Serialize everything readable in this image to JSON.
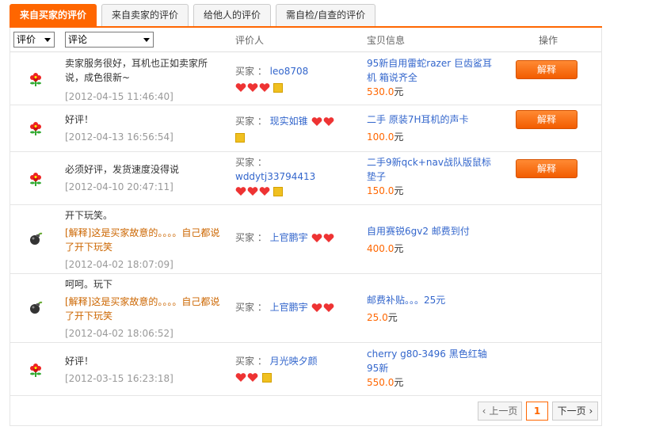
{
  "tabs": [
    {
      "label": "来自买家的评价",
      "active": true
    },
    {
      "label": "来自卖家的评价",
      "active": false
    },
    {
      "label": "给他人的评价",
      "active": false
    },
    {
      "label": "需自检/自查的评价",
      "active": false
    }
  ],
  "header": {
    "filter_rating": "评价",
    "filter_comment": "评论",
    "col_reviewer": "评价人",
    "col_item": "宝贝信息",
    "col_action": "操作"
  },
  "rows": [
    {
      "icon": "flower-icon",
      "comment": "卖家服务很好，耳机也正如卖家所说，成色很新~",
      "reply": "",
      "time": "[2012-04-15 11:46:40]",
      "buyer_label": "买家 ：",
      "buyer_name": "leo8708",
      "item_title": "95新自用雷蛇razer 巨齿鲨耳机 箱说齐全",
      "price": "530.0",
      "unit": "元",
      "action": "解释"
    },
    {
      "icon": "flower-icon",
      "comment": "好评！",
      "reply": "",
      "time": "[2012-04-13 16:56:54]",
      "buyer_label": "买家 ：",
      "buyer_name": "现实如锥",
      "item_title": "二手 原装7H耳机的声卡",
      "price": "100.0",
      "unit": "元",
      "action": "解释"
    },
    {
      "icon": "flower-icon",
      "comment": "必须好评，发货速度没得说",
      "reply": "",
      "time": "[2012-04-10 20:47:11]",
      "buyer_label": "买家 ：",
      "buyer_name": "wddytj33794413",
      "item_title": "二手9新qck+nav战队版鼠标垫子",
      "price": "150.0",
      "unit": "元",
      "action": "解释"
    },
    {
      "icon": "bomb-icon",
      "comment": "开下玩笑。",
      "reply": "[解释]这是买家故意的。。。。自己都说了开下玩笑",
      "time": "[2012-04-02 18:07:09]",
      "buyer_label": "买家 ：",
      "buyer_name": "上官鹏宇",
      "item_title": "自用赛锐6gv2 邮费到付",
      "price": "400.0",
      "unit": "元",
      "action": ""
    },
    {
      "icon": "bomb-icon",
      "comment": "呵呵。玩下",
      "reply": "[解释]这是买家故意的。。。。自己都说了开下玩笑",
      "time": "[2012-04-02 18:06:52]",
      "buyer_label": "买家 ：",
      "buyer_name": "上官鹏宇",
      "item_title": "邮费补贴。。。25元",
      "price": "25.0",
      "unit": "元",
      "action": ""
    },
    {
      "icon": "flower-icon",
      "comment": "好评！",
      "reply": "",
      "time": "[2012-03-15 16:23:18]",
      "buyer_label": "买家 ：",
      "buyer_name": "月光映夕颜",
      "item_title": "cherry g80-3496 黑色红轴 95新",
      "price": "550.0",
      "unit": "元",
      "action": ""
    }
  ],
  "pager": {
    "prev": "上一页",
    "current": "1",
    "next": "下一页"
  },
  "colors": {
    "accent": "#ff6600",
    "link": "#3366cc",
    "reply": "#cc6600"
  }
}
